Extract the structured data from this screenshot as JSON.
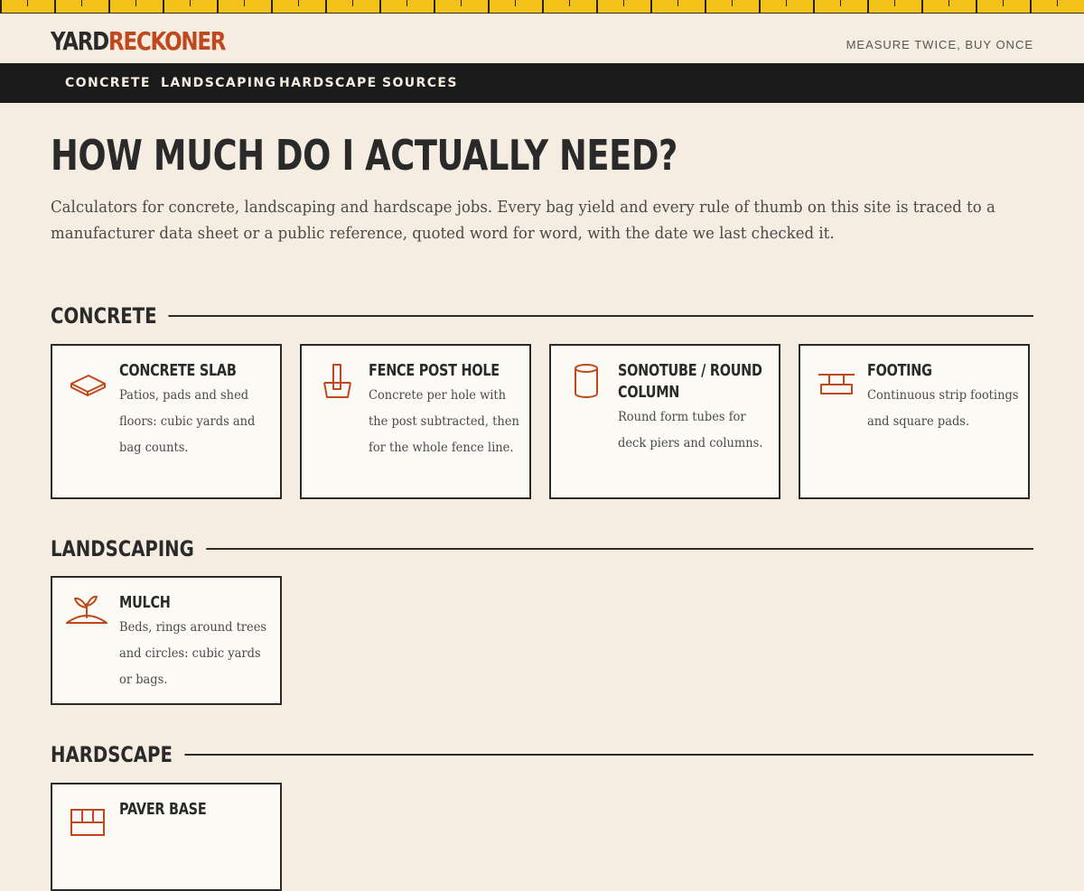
{
  "brand": {
    "logo_part1": "YARD",
    "logo_part2": "RECKONER",
    "tagline": "MEASURE TWICE, BUY ONCE",
    "accent_color": "#c0481c",
    "ruler_color": "#f2c21a"
  },
  "nav": {
    "items": [
      {
        "label": "CONCRETE"
      },
      {
        "label": "LANDSCAPING"
      },
      {
        "label": "HARDSCAPE"
      },
      {
        "label": "SOURCES"
      }
    ]
  },
  "hero": {
    "title": "HOW MUCH DO I ACTUALLY NEED?",
    "intro": "Calculators for concrete, landscaping and hardscape jobs. Every bag yield and every rule of thumb on this site is traced to a manufacturer data sheet or a public reference, quoted word for word, with the date we last checked it."
  },
  "sections": {
    "concrete": {
      "title": "CONCRETE",
      "cards": [
        {
          "title": "CONCRETE SLAB",
          "description": "Patios, pads and shed floors: cubic yards and bag counts.",
          "icon": "slab-icon"
        },
        {
          "title": "FENCE POST HOLE",
          "description": "Concrete per hole with the post subtracted, then for the whole fence line.",
          "icon": "post-hole-icon"
        },
        {
          "title": "SONOTUBE / ROUND COLUMN",
          "description": "Round form tubes for deck piers and columns.",
          "icon": "cylinder-icon"
        },
        {
          "title": "FOOTING",
          "description": "Continuous strip footings and square pads.",
          "icon": "footing-icon"
        }
      ]
    },
    "landscaping": {
      "title": "LANDSCAPING",
      "cards": [
        {
          "title": "MULCH",
          "description": "Beds, rings around trees and circles: cubic yards or bags.",
          "icon": "sprout-icon"
        }
      ]
    },
    "hardscape": {
      "title": "HARDSCAPE",
      "cards": [
        {
          "title": "PAVER BASE",
          "description": "",
          "icon": "paver-icon"
        }
      ]
    }
  }
}
